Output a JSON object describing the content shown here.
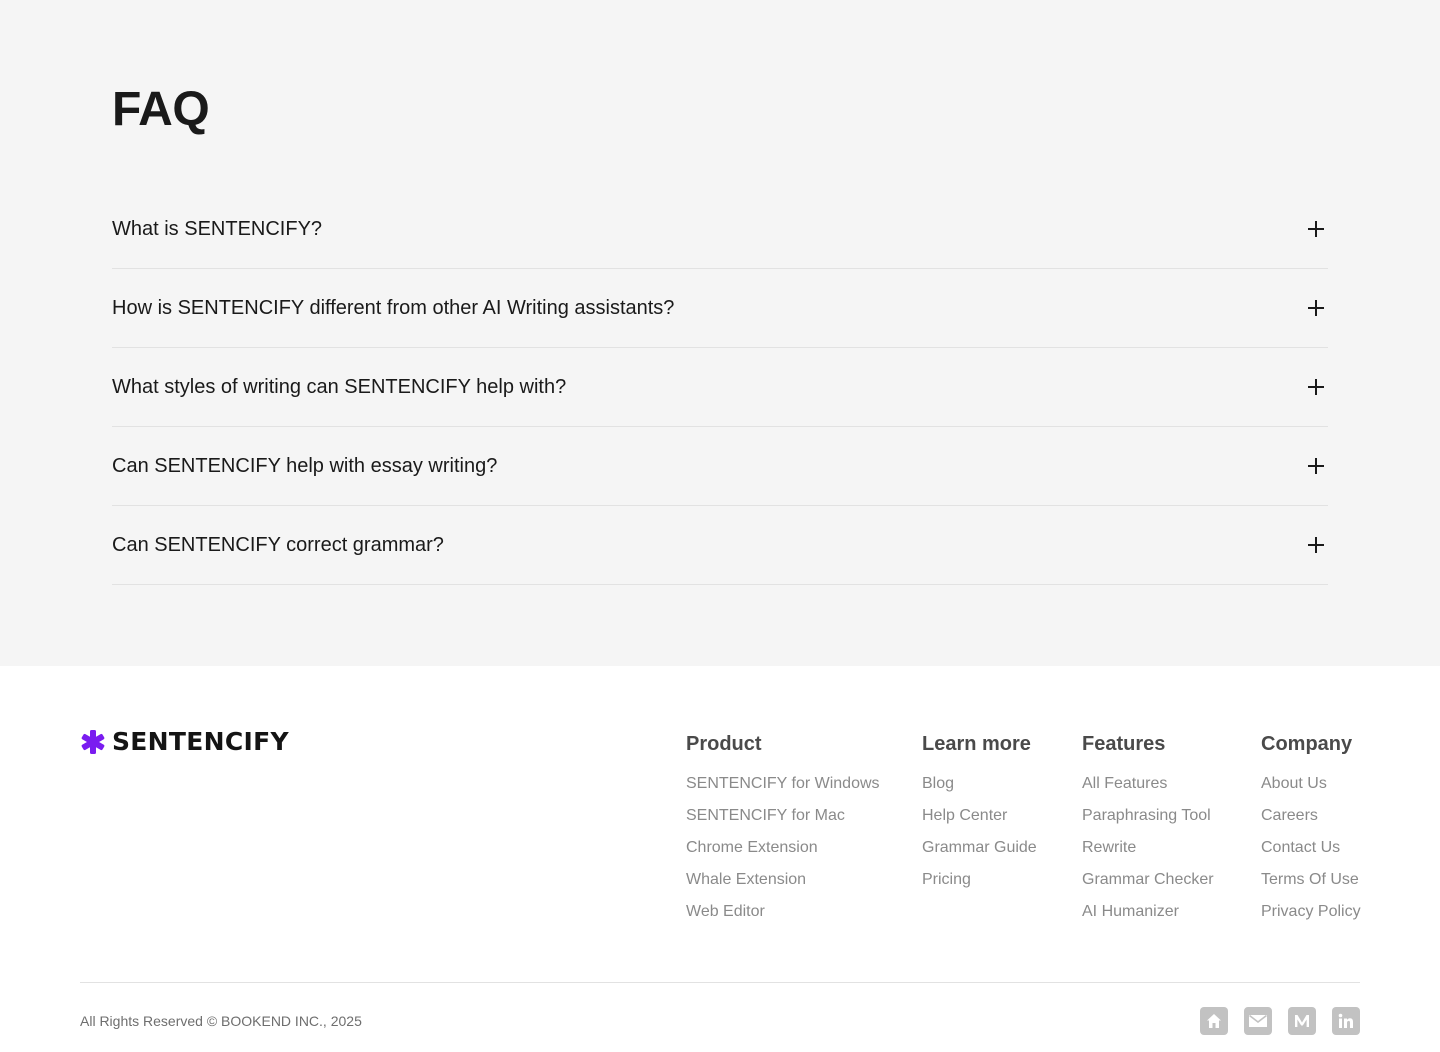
{
  "faq": {
    "title": "FAQ",
    "items": [
      {
        "question": "What is SENTENCIFY?"
      },
      {
        "question": "How is SENTENCIFY different from other AI Writing assistants?"
      },
      {
        "question": "What styles of writing can SENTENCIFY help with?"
      },
      {
        "question": "Can SENTENCIFY help with essay writing?"
      },
      {
        "question": "Can SENTENCIFY correct grammar?"
      }
    ],
    "expand_icon": "plus-icon"
  },
  "footer": {
    "brand": {
      "name": "SENTENCIFY",
      "accent_color": "#7a1cf0",
      "mark_icon": "asterisk-icon"
    },
    "columns": {
      "product": {
        "title": "Product",
        "links": [
          "SENTENCIFY for Windows",
          "SENTENCIFY for Mac",
          "Chrome Extension",
          "Whale Extension",
          "Web Editor"
        ]
      },
      "learn_more": {
        "title": "Learn more",
        "links": [
          "Blog",
          "Help Center",
          "Grammar Guide",
          "Pricing"
        ]
      },
      "features": {
        "title": "Features",
        "links": [
          "All Features",
          "Paraphrasing Tool",
          "Rewrite",
          "Grammar Checker",
          "AI Humanizer"
        ]
      },
      "company": {
        "title": "Company",
        "links": [
          "About Us",
          "Careers",
          "Contact Us",
          "Terms Of Use",
          "Privacy Policy"
        ]
      }
    },
    "copyright": "All Rights Reserved © BOOKEND INC., 2025",
    "social_icons": [
      "home-icon",
      "mail-icon",
      "medium-icon",
      "linkedin-icon"
    ]
  },
  "colors": {
    "faq_background": "#f5f5f5",
    "divider": "#e2e2e2",
    "link_gray": "#8a8a8a",
    "social_icon_bg": "#c2c2c2"
  }
}
